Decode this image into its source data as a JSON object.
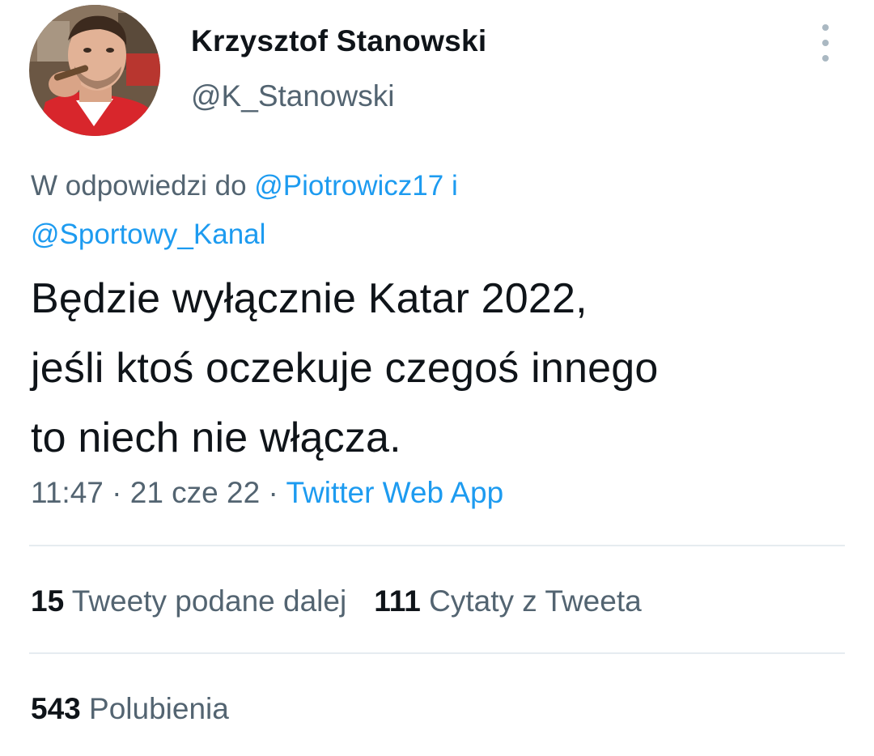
{
  "author": {
    "name": "Krzysztof Stanowski",
    "handle": "@K_Stanowski"
  },
  "reply_to": {
    "prefix": "W odpowiedzi do",
    "mention1": "@Piotrowicz17",
    "conjunction": "i",
    "mention2": "@Sportowy_Kanal"
  },
  "tweet": {
    "lines": [
      "Będzie wyłącznie Katar 2022,",
      "jeśli ktoś oczekuje czegoś innego",
      "to niech nie włącza."
    ]
  },
  "meta": {
    "time": "11:47",
    "sep1": "·",
    "date": "21 cze 22",
    "sep2": "·",
    "source": "Twitter Web App"
  },
  "stats": {
    "retweets_count": "15",
    "retweets_label": "Tweety podane dalej",
    "quotes_count": "111",
    "quotes_label": "Cytaty z Tweeta",
    "likes_count": "543",
    "likes_label": "Polubienia"
  },
  "icons": {
    "more": "more-vertical-icon"
  },
  "colors": {
    "accent": "#1d9bf0",
    "text": "#0f1419",
    "secondary": "#536471",
    "divider": "#e6ecf0"
  }
}
